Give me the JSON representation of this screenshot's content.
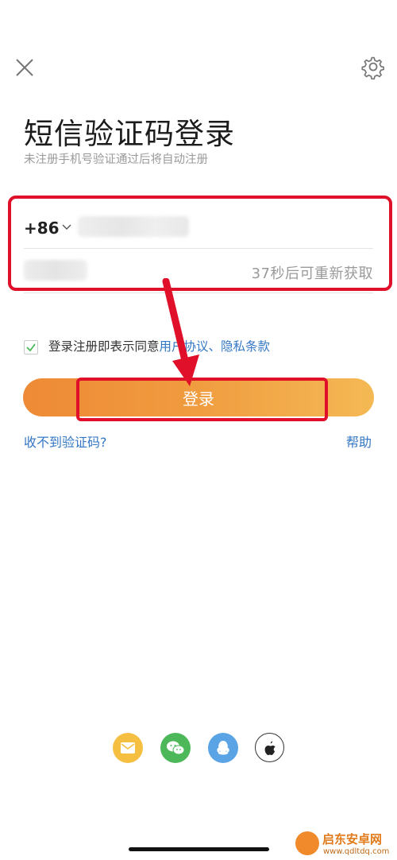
{
  "header": {
    "title": "短信验证码登录",
    "subtitle": "未注册手机号验证通过后将自动注册"
  },
  "phone": {
    "country_code": "+86"
  },
  "code": {
    "countdown": "37秒后可重新获取"
  },
  "agreement": {
    "prefix": "登录注册即表示同意",
    "user_agreement": "用户协议",
    "separator": "、",
    "privacy": "隐私条款"
  },
  "actions": {
    "login": "登录",
    "no_code": "收不到验证码?",
    "help": "帮助"
  },
  "social_icons": [
    "mail-icon",
    "wechat-icon",
    "qq-icon",
    "apple-icon"
  ],
  "colors": {
    "accent_start": "#ee8a36",
    "accent_end": "#f4b954",
    "link": "#3477c4",
    "annotation": "#e0102a"
  },
  "watermark": {
    "name": "启东安卓网",
    "url": "www.qdltdq.com"
  }
}
